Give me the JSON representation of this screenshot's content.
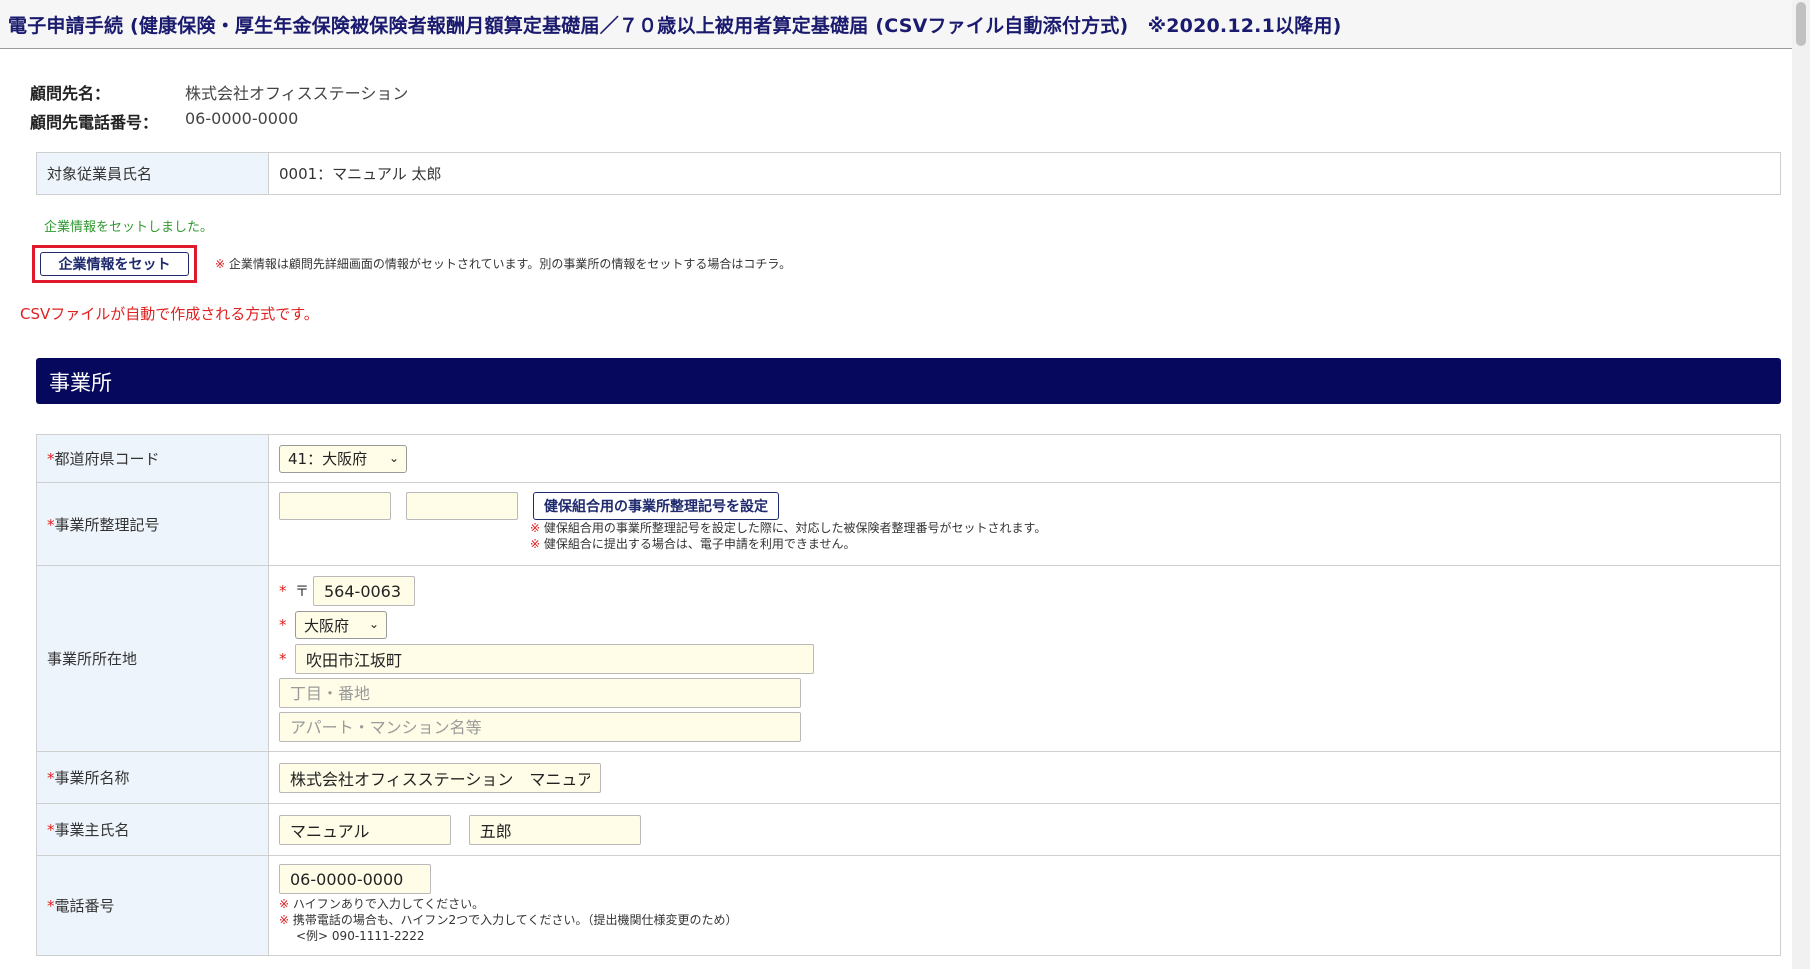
{
  "title": "電子申請手続 (健康保険・厚生年金保険被保険者報酬月額算定基礎届／７０歳以上被用者算定基礎届 (CSVファイル自動添付方式)　※2020.12.1以降用)",
  "client": {
    "name_label": "顧問先名：",
    "name_value": "株式会社オフィスステーション",
    "phone_label": "顧問先電話番号：",
    "phone_value": "06-0000-0000"
  },
  "employee": {
    "label": "対象従業員氏名",
    "value": "0001：マニュアル 太郎"
  },
  "company_set": {
    "success_message": "企業情報をセットしました。",
    "button_label": "企業情報をセット",
    "note_mark": "※",
    "note_text": "企業情報は顧問先詳細画面の情報がセットされています。別の事業所の情報をセットする場合はコチラ。"
  },
  "csv_notice": "CSVファイルが自動で作成される方式です。",
  "section": {
    "title": "事業所"
  },
  "form": {
    "required_mark": "*",
    "prefecture_code": {
      "label": "都道府県コード",
      "selected": "41：大阪府"
    },
    "office_number": {
      "label": "事業所整理記号",
      "value1": "",
      "value2": "",
      "button_label": "健保組合用の事業所整理記号を設定",
      "note1": "健保組合用の事業所整理記号を設定した際に、対応した被保険者整理番号がセットされます。",
      "note2": "健保組合に提出する場合は、電子申請を利用できません。",
      "note_mark": "※"
    },
    "address": {
      "label": "事業所所在地",
      "postal_mark": "〒",
      "postal_code": "564-0063",
      "prefecture": "大阪府",
      "city": "吹田市江坂町",
      "block_placeholder": "丁目・番地",
      "building_placeholder": "アパート・マンション名等"
    },
    "office_name": {
      "label": "事業所名称",
      "value": "株式会社オフィスステーション　マニュアル"
    },
    "owner_name": {
      "label": "事業主氏名",
      "last_name": "マニュアル",
      "first_name": "五郎"
    },
    "phone": {
      "label": "電話番号",
      "value": "06-0000-0000",
      "note_mark": "※",
      "note1": "ハイフンありで入力してください。",
      "note2": "携帯電話の場合も、ハイフン2つで入力してください。（提出機関仕様変更のため）",
      "example": "<例> 090-1111-2222"
    }
  },
  "colors": {
    "title_text": "#1a1a6e",
    "section_bar": "#06085e",
    "required": "#e02020",
    "success": "#2f9a2f",
    "highlight_border": "#e0182b",
    "label_bg": "#eef4fb",
    "input_bg": "#fffde8"
  }
}
